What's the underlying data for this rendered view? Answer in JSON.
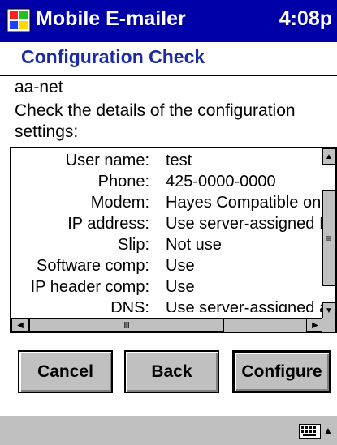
{
  "titlebar": {
    "app_title": "Mobile E-mailer",
    "time": "4:08p"
  },
  "page": {
    "title": "Configuration Check"
  },
  "account": "aa-net",
  "instruction": "Check the details of the configuration settings:",
  "settings": [
    {
      "label": "User name:",
      "value": "test"
    },
    {
      "label": "Phone:",
      "value": "425-0000-0000"
    },
    {
      "label": "Modem:",
      "value": "Hayes Compatible on"
    },
    {
      "label": "IP address:",
      "value": "Use server-assigned I"
    },
    {
      "label": "Slip:",
      "value": "Not use"
    },
    {
      "label": "Software comp:",
      "value": "Use"
    },
    {
      "label": "IP header comp:",
      "value": "Use"
    },
    {
      "label": "DNS:",
      "value": "Use server-assigned a"
    }
  ],
  "buttons": {
    "cancel": "Cancel",
    "back": "Back",
    "configure": "Configure"
  },
  "icons": {
    "windows": "windows-flag-icon",
    "keyboard": "keyboard-icon",
    "sip": "sip-arrow-icon",
    "scroll_up": "scroll-up-icon",
    "scroll_down": "scroll-down-icon",
    "scroll_left": "scroll-left-icon",
    "scroll_right": "scroll-right-icon"
  },
  "colors": {
    "titlebar": "#0000a8",
    "heading": "#1a2aa8",
    "chrome": "#c0c0c0"
  }
}
